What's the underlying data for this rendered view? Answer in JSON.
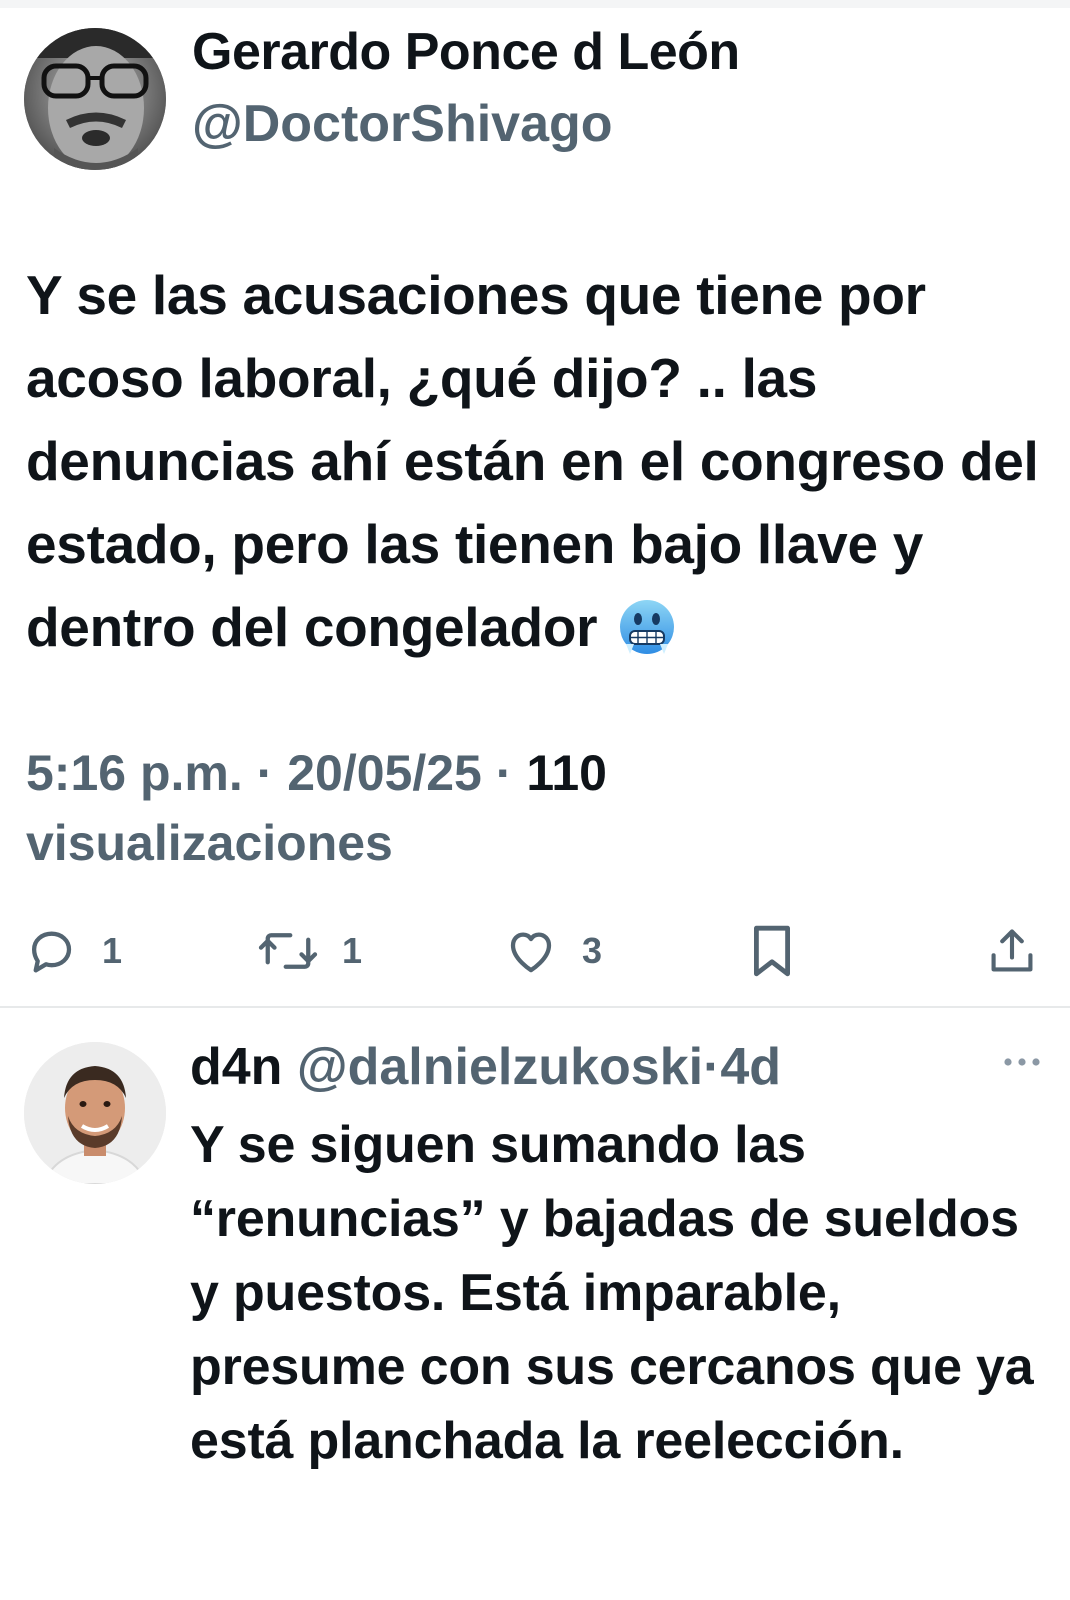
{
  "tweet": {
    "author_name": "Gerardo Ponce d León",
    "author_handle": "@DoctorShivago",
    "text": "Y se las acusaciones que tiene por acoso laboral, ¿qué dijo? .. las denuncias ahí están en el congreso del estado, pero las tienen bajo llave y dentro del congelador",
    "emoji": "cold-face-emoji",
    "time": "5:16 p.m.",
    "date": "20/05/25",
    "separator": "·",
    "views_count": "110",
    "views_label": "visualizaciones",
    "actions": {
      "reply_count": "1",
      "retweet_count": "1",
      "like_count": "3"
    }
  },
  "reply": {
    "author_name": "d4n",
    "author_handle": "@dalnielzukoski",
    "separator": "·",
    "time_ago": "4d",
    "text": "Y se siguen sumando las “renuncias” y bajadas de sueldos y puestos. Está imparable, presume con sus cercanos que ya está planchada la reelección."
  },
  "colors": {
    "text_primary": "#0f1419",
    "text_secondary": "#536471",
    "divider": "#e7e9ea"
  },
  "icons": [
    "reply-icon",
    "retweet-icon",
    "like-icon",
    "bookmark-icon",
    "share-icon",
    "more-icon"
  ]
}
